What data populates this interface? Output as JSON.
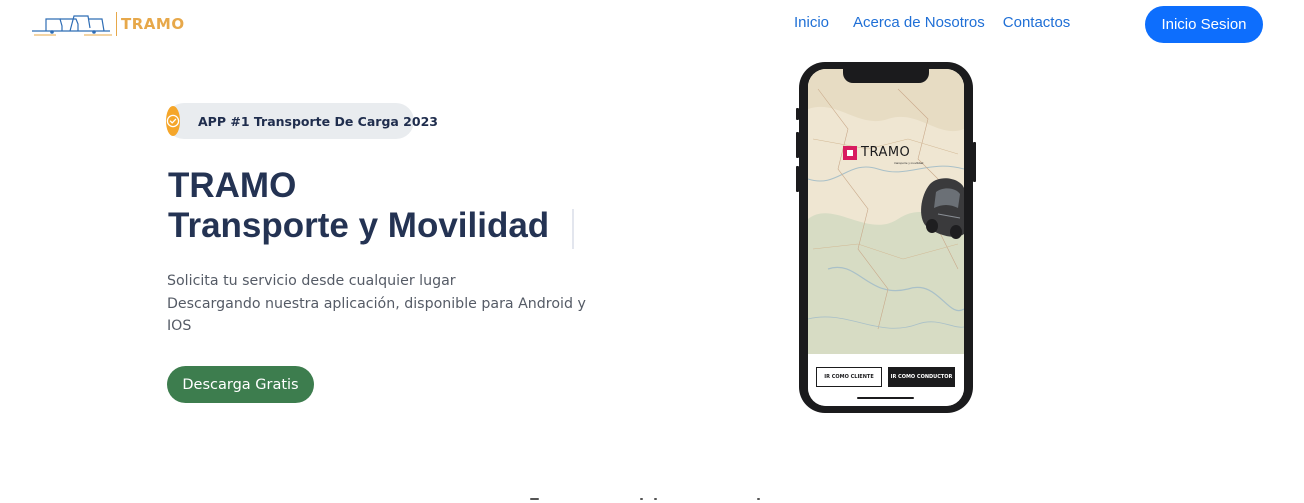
{
  "brand": {
    "name": "TRAMO",
    "accent": "#e7a84a"
  },
  "nav": {
    "links": [
      "Inicio",
      "Acerca de Nosotros",
      "Contactos"
    ],
    "login_label": "Inicio Sesion"
  },
  "hero": {
    "badge_text": "APP #1 Transporte De Carga 2023",
    "badge_icon": "check-circle-icon",
    "title_line1": "TRAMO",
    "title_line2": "Transporte y Movilidad",
    "description_line1": "Solicita tu servicio desde cualquier lugar",
    "description_line2": "Descargando nuestra aplicación, disponible para Android y",
    "description_line3": "IOS",
    "download_label": "Descarga Gratis"
  },
  "phone": {
    "app_logo_text": "TRAMO",
    "app_logo_sub": "transporte y movilidad",
    "client_button": "IR COMO CLIENTE",
    "driver_button": "IR COMO CONDUCTOR"
  },
  "colors": {
    "primary": "#0d6efd",
    "nav_link": "#1f6fd6",
    "download": "#3d7d4e",
    "badge_icon_bg": "#f5a62a",
    "title": "#243353"
  }
}
